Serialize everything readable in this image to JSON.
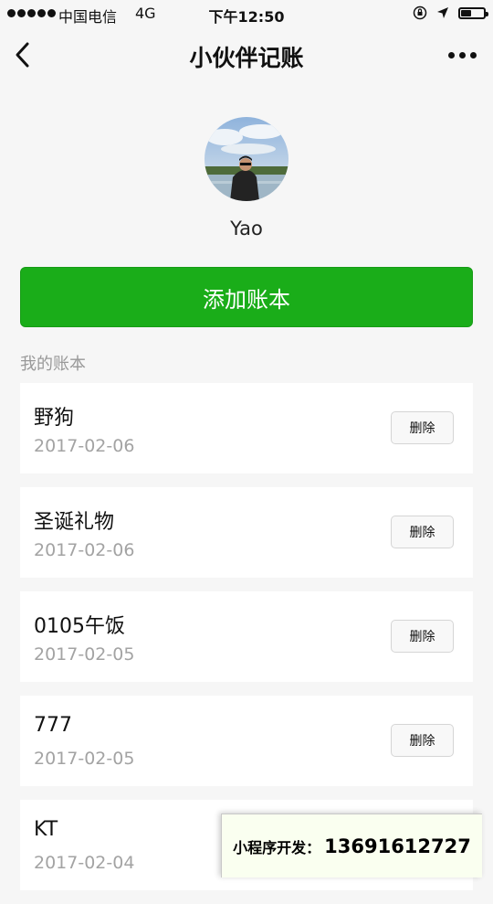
{
  "status_bar": {
    "carrier": "中国电信",
    "network": "4G",
    "time": "下午12:50",
    "battery_level": 0.45
  },
  "nav": {
    "title": "小伙伴记账"
  },
  "profile": {
    "name": "Yao"
  },
  "add_book_label": "添加账本",
  "section_title": "我的账本",
  "delete_label": "删除",
  "books": [
    {
      "name": "野狗",
      "date": "2017-02-06"
    },
    {
      "name": "圣诞礼物",
      "date": "2017-02-06"
    },
    {
      "name": "0105午饭",
      "date": "2017-02-05"
    },
    {
      "name": "777",
      "date": "2017-02-05"
    },
    {
      "name": "KT",
      "date": "2017-02-04"
    }
  ],
  "promo": {
    "label": "小程序开发：",
    "phone": "13691612727"
  },
  "colors": {
    "brand_green": "#1aad19",
    "background": "#f6f6f6",
    "date_gray": "#a3a3a3"
  },
  "icons": {
    "back": "chevron-left-icon",
    "more": "more-icon",
    "lock_rotation": "lock-rotation-icon",
    "location": "location-arrow-icon",
    "battery": "battery-icon"
  }
}
